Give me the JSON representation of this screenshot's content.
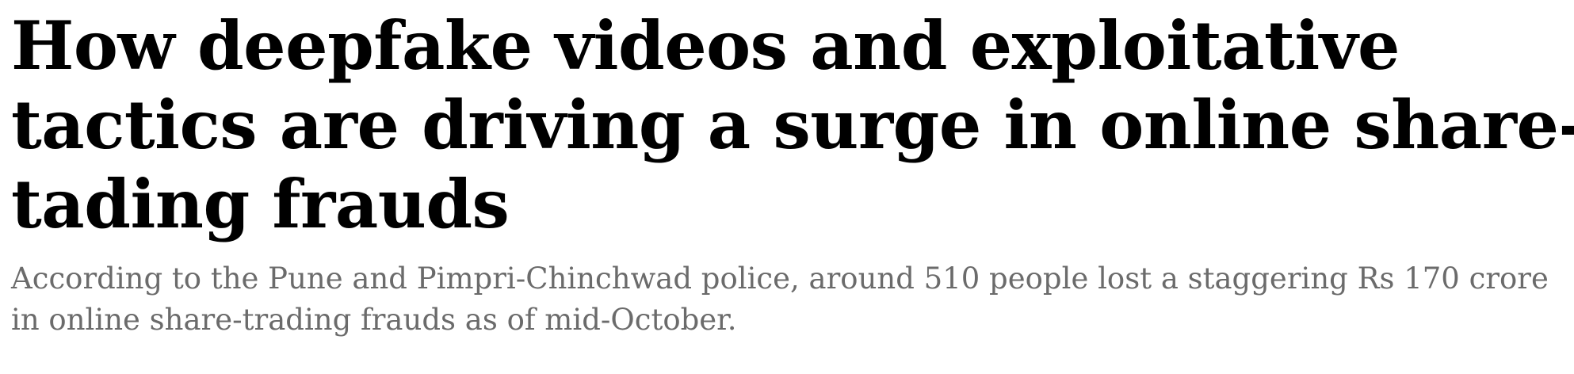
{
  "article": {
    "headline_lines": [
      "How deepfake videos and exploitative",
      "tactics are driving a surge in online share-",
      "tading frauds"
    ],
    "summary_lines": [
      "According to the Pune and Pimpri-Chinchwad police, around 510 people lost a staggering Rs 170 crore",
      "in online share-trading frauds as of mid-October."
    ]
  },
  "colors": {
    "headline_text": "#000000",
    "summary_text": "#6b6b6b",
    "background": "#ffffff"
  }
}
